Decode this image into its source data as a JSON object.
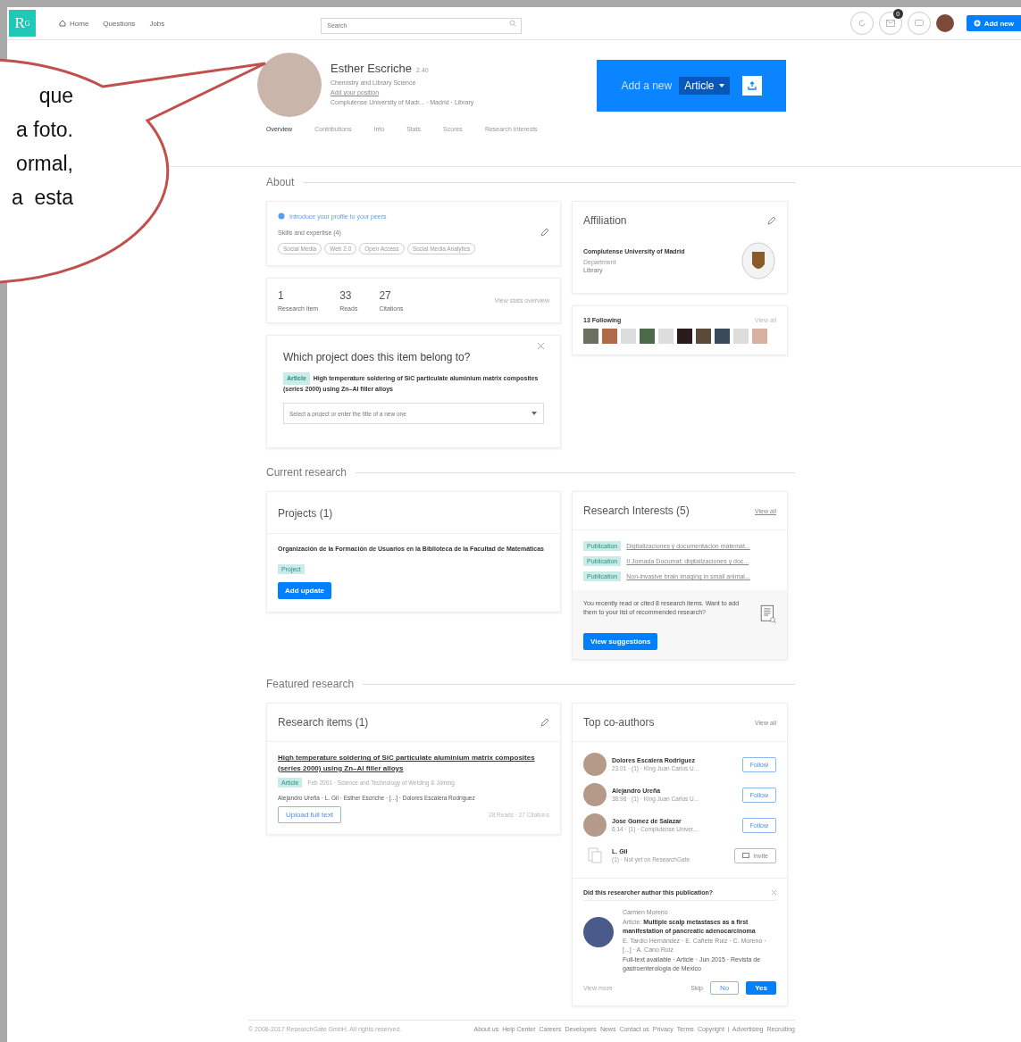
{
  "top_nav": {
    "logo": "R",
    "logo_sup": "G",
    "links": [
      "Home",
      "Questions",
      "Jobs"
    ],
    "search": {
      "placeholder": "Search"
    },
    "badge": "0",
    "add_button": "Add new"
  },
  "callout": {
    "lines": [
      "que",
      "a foto.",
      "ormal,",
      "a  esta"
    ]
  },
  "profile": {
    "name": "Esther Escriche",
    "score": "2.40",
    "degree": "Chemistry and Library Science",
    "position_link": "Add your position",
    "institution": "Complutense University of Madr... · Madrid · Library"
  },
  "cta": {
    "text": "Add a new",
    "type": "Article"
  },
  "tabs": [
    {
      "label": "Overview",
      "selected": true
    },
    {
      "label": "Contributions",
      "selected": false
    },
    {
      "label": "Info",
      "selected": false
    },
    {
      "label": "Stats",
      "selected": false
    },
    {
      "label": "Scores",
      "selected": false
    },
    {
      "label": "Research Interests",
      "selected": false
    }
  ],
  "about": {
    "heading": "About",
    "intro_link": "Introduce your profile to your peers",
    "skills_label": "Skills and expertise (4)",
    "skills": [
      "Social Media",
      "Web 2.0",
      "Open Access",
      "Social Media Analytics"
    ],
    "stats": [
      {
        "value": "1",
        "label": "Research item"
      },
      {
        "value": "33",
        "label": "Reads"
      },
      {
        "value": "27",
        "label": "Citations"
      }
    ],
    "stats_link": "View stats overview"
  },
  "project_prompt": {
    "title": "Which project does this item belong to?",
    "tag": "Article",
    "item": "High temperature soldering of SiC particulate aluminium matrix composites (series 2000) using Zn–Al filler alloys",
    "select_placeholder": "Select a project or enter the title of a new one"
  },
  "affiliation": {
    "heading": "Affiliation",
    "institution": "Complutense University of Madrid",
    "department_label": "Department",
    "department": "Library"
  },
  "following": {
    "heading": "13 Following",
    "link": "View all"
  },
  "current_research": {
    "heading": "Current research",
    "projects": {
      "heading": "Projects (1)",
      "title": "Organización de la Formación de Usuarios en la Biblioteca de la Facultad de Matemáticas",
      "tag": "Project",
      "button": "Add update"
    },
    "interests": {
      "heading": "Research Interests (5)",
      "link": "View all",
      "items": [
        {
          "tag": "Publication",
          "title": "Digitalizaciones y documentación matemát..."
        },
        {
          "tag": "Publication",
          "title": "II Jornada Documat: digitalizaciones y doc..."
        },
        {
          "tag": "Publication",
          "title": "Non-invasive brain imaging in small animal..."
        }
      ],
      "suggestion": "You recently read or cited 8 research items. Want to add them to your list of recommended research?",
      "button": "View suggestions"
    }
  },
  "featured_research": {
    "heading": "Featured research",
    "research_items": {
      "heading": "Research items (1)",
      "title": "High temperature soldering of SiC particulate aluminium matrix composites (series 2000) using Zn–Al filler alloys",
      "tag": "Article",
      "meta": "Feb 2001 · Science and Technology of Welding & Joining",
      "authors": "Alejandro Ureña · L. Gil · Esther Escriche · [...] · Dolores Escalera Rodriguez",
      "button": "Upload full text",
      "stats": "28 Reads · 27 Citations"
    },
    "coauthors": {
      "heading": "Top co-authors",
      "link": "View all",
      "items": [
        {
          "kind": "follow",
          "name": "Dolores Escalera Rodriguez",
          "meta": "23.01 · (1) · King Juan Carlos U...",
          "action": "Follow"
        },
        {
          "kind": "follow",
          "name": "Alejandro Ureña",
          "meta": "38.98 · (1) · King Juan Carlos U...",
          "action": "Follow"
        },
        {
          "kind": "follow",
          "name": "Jose Gomez de Salazar",
          "meta": "6.14 · (1) · Complutense Univer...",
          "action": "Follow"
        },
        {
          "kind": "invite",
          "name": "L. Gil",
          "meta": "(1) · Not yet on ResearchGate",
          "action": "Invite"
        }
      ]
    },
    "author_prompt": {
      "question": "Did this researcher author this publication?",
      "name": "Carmen Moreno",
      "type": "Article:",
      "title": "Multiple scalp metastases as a first manifestation of pancreatic adenocarcinoma",
      "authors": "E. Tardío Hernández · E. Cañete Ruiz · C. Moreno · [...] · A. Cano Ruiz",
      "meta": "Full-text available · Article · Jun 2015 · Revista de gastroenterologia de Mexico",
      "view_more": "View more",
      "skip": "Skip",
      "no": "No",
      "yes": "Yes"
    }
  },
  "footer": {
    "copyright": "© 2008-2017 ResearchGate GmbH. All rights reserved.",
    "links": [
      "About us",
      "Help Center",
      "Careers",
      "Developers",
      "News",
      "Contact us",
      "Privacy",
      "Terms",
      "Copyright",
      "Advertising",
      "Recruiting"
    ]
  }
}
